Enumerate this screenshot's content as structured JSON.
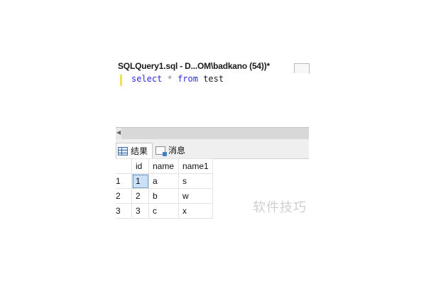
{
  "editor_tab": {
    "title": "SQLQuery1.sql - D...OM\\badkano (54))*"
  },
  "query": {
    "keyword_select": "select",
    "star": "*",
    "keyword_from": "from",
    "table": "test"
  },
  "results_tabs": [
    {
      "label": "结果",
      "icon": "grid-icon",
      "active": true
    },
    {
      "label": "消息",
      "icon": "messages-icon",
      "active": false
    }
  ],
  "grid": {
    "columns": [
      "id",
      "name",
      "name1"
    ],
    "rows": [
      {
        "num": "1",
        "id": "1",
        "name": "a",
        "name1": "s"
      },
      {
        "num": "2",
        "id": "2",
        "name": "b",
        "name1": "w"
      },
      {
        "num": "3",
        "id": "3",
        "name": "c",
        "name1": "x"
      }
    ]
  },
  "watermark": "软件技巧"
}
